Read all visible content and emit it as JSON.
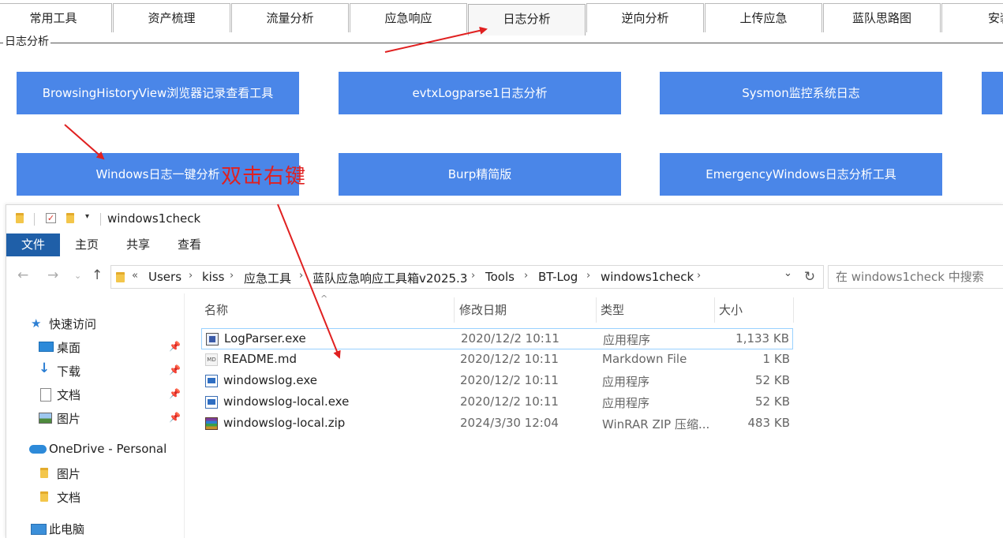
{
  "app": {
    "tabs": [
      "常用工具",
      "资产梳理",
      "流量分析",
      "应急响应",
      "日志分析",
      "逆向分析",
      "上传应急",
      "蓝队思路图",
      "安装"
    ],
    "active_tab_index": 4,
    "group_title": "日志分析",
    "tools_row1": [
      "BrowsingHistoryView浏览器记录查看工具",
      "evtxLogparse1日志分析",
      "Sysmon监控系统日志"
    ],
    "tools_row2": [
      "Windows日志一键分析",
      "Burp精简版",
      "EmergencyWindows日志分析工具"
    ],
    "button_color": "#4a86e8"
  },
  "annotation": {
    "text": "双击右键",
    "color": "#e02020"
  },
  "explorer": {
    "title": "windows1check",
    "ribbon_tabs": [
      "文件",
      "主页",
      "共享",
      "查看"
    ],
    "breadcrumb": [
      "Users",
      "kiss",
      "应急工具",
      "蓝队应急响应工具箱v2025.3",
      "Tools",
      "BT-Log",
      "windows1check"
    ],
    "search_placeholder": "在 windows1check 中搜索",
    "nav": {
      "quick_access": "快速访问",
      "quick_items": [
        "桌面",
        "下载",
        "文档",
        "图片"
      ],
      "onedrive": "OneDrive - Personal",
      "onedrive_items": [
        "图片",
        "文档"
      ],
      "this_pc": "此电脑"
    },
    "columns": {
      "name": "名称",
      "date": "修改日期",
      "type": "类型",
      "size": "大小"
    },
    "files": [
      {
        "name": "LogParser.exe",
        "date": "2020/12/2 10:11",
        "type": "应用程序",
        "size": "1,133 KB",
        "icon": "logparser-exe-icon"
      },
      {
        "name": "README.md",
        "date": "2020/12/2 10:11",
        "type": "Markdown File",
        "size": "1 KB",
        "icon": "markdown-file-icon"
      },
      {
        "name": "windowslog.exe",
        "date": "2020/12/2 10:11",
        "type": "应用程序",
        "size": "52 KB",
        "icon": "exe-icon"
      },
      {
        "name": "windowslog-local.exe",
        "date": "2020/12/2 10:11",
        "type": "应用程序",
        "size": "52 KB",
        "icon": "exe-icon"
      },
      {
        "name": "windowslog-local.zip",
        "date": "2024/3/30 12:04",
        "type": "WinRAR ZIP 压缩...",
        "size": "483 KB",
        "icon": "winrar-zip-icon"
      }
    ],
    "selected_file_index": 0
  }
}
